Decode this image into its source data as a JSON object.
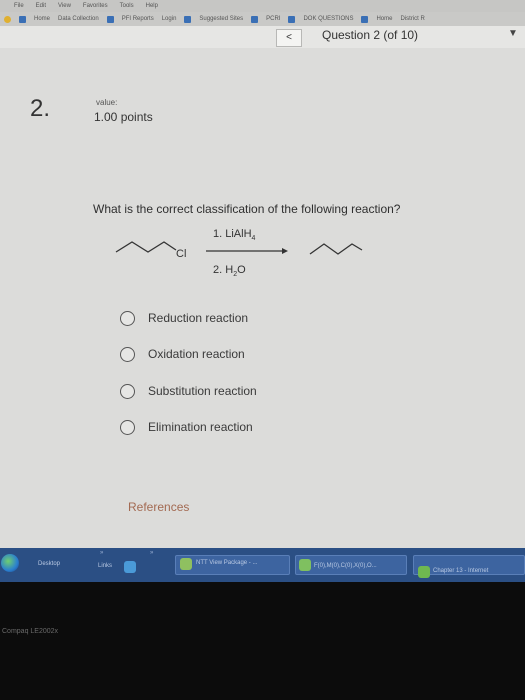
{
  "browser": {
    "menu": [
      "File",
      "Edit",
      "View",
      "Favorites",
      "Tools",
      "Help"
    ],
    "favorites": [
      "Home",
      "Data Collection",
      "PFI Reports",
      "Login",
      "Suggested Sites",
      "PCRI",
      "DOK QUESTIONS",
      "Home",
      "District R"
    ],
    "back_label": "<",
    "question_counter": "Question 2 (of 10)",
    "dropdown_label": "▼"
  },
  "question": {
    "number": "2.",
    "value_label": "value:",
    "points": "1.00 points",
    "text": "What is the correct classification of the following reaction?",
    "reagent_1": "1. LiAlH",
    "reagent_1_sub": "4",
    "reagent_2": "2. H",
    "reagent_2_sub": "2",
    "reagent_2_end": "O",
    "leaving_group": "Cl"
  },
  "choices": [
    {
      "label": "Reduction reaction"
    },
    {
      "label": "Oxidation reaction"
    },
    {
      "label": "Substitution reaction"
    },
    {
      "label": "Elimination reaction"
    }
  ],
  "references_label": "References",
  "taskbar": {
    "desktop": "Desktop",
    "links": "Links",
    "window_1": "NTT View Package - ...",
    "window_2": "F(0),M(0),C(0),X(0),O...",
    "window_3": "Chapter 13 - Internet"
  },
  "monitor_brand": "Compaq LE2002x"
}
